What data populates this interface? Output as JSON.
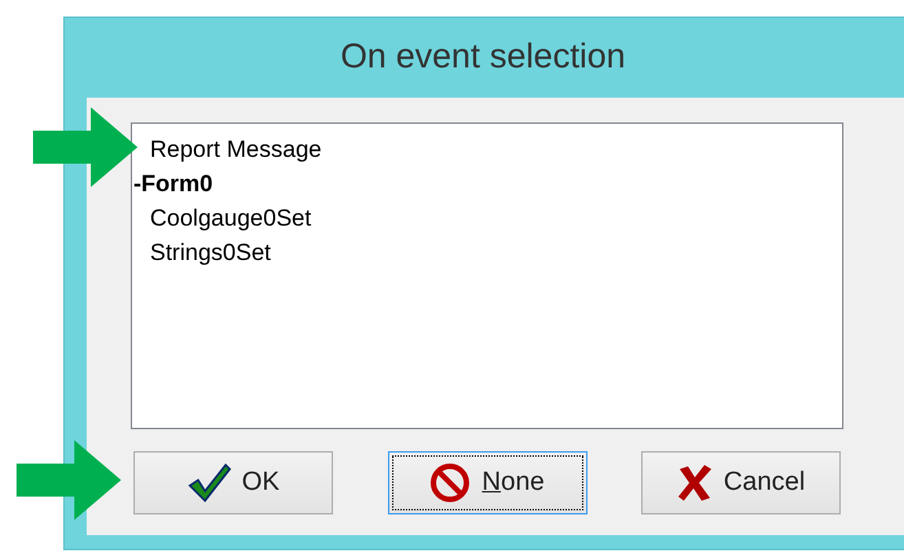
{
  "window": {
    "title": "On event selection"
  },
  "list": {
    "items": [
      {
        "label": "Report Message",
        "kind": "item"
      },
      {
        "label": "-Form0",
        "kind": "group"
      },
      {
        "label": "Coolgauge0Set",
        "kind": "item"
      },
      {
        "label": "Strings0Set",
        "kind": "item"
      }
    ]
  },
  "buttons": [
    {
      "label": "OK",
      "kind": "check",
      "focused": false,
      "underline_first": false
    },
    {
      "label": "None",
      "kind": "none",
      "focused": true,
      "underline_first": true
    },
    {
      "label": "Cancel",
      "kind": "cross",
      "focused": false,
      "underline_first": false
    }
  ]
}
